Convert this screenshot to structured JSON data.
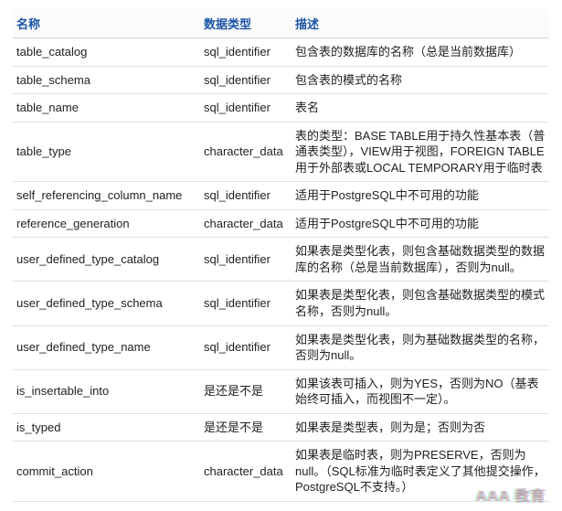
{
  "headers": {
    "name": "名称",
    "datatype": "数据类型",
    "desc": "描述"
  },
  "rows": [
    {
      "name": "table_catalog",
      "datatype": "sql_identifier",
      "desc": "包含表的数据库的名称（总是当前数据库）"
    },
    {
      "name": "table_schema",
      "datatype": "sql_identifier",
      "desc": "包含表的模式的名称"
    },
    {
      "name": "table_name",
      "datatype": "sql_identifier",
      "desc": "表名"
    },
    {
      "name": "table_type",
      "datatype": "character_data",
      "desc": "表的类型：BASE TABLE用于持久性基本表（普通表类型），VIEW用于视图，FOREIGN TABLE用于外部表或LOCAL TEMPORARY用于临时表"
    },
    {
      "name": "self_referencing_column_name",
      "datatype": "sql_identifier",
      "desc": "适用于PostgreSQL中不可用的功能"
    },
    {
      "name": "reference_generation",
      "datatype": "character_data",
      "desc": "适用于PostgreSQL中不可用的功能"
    },
    {
      "name": "user_defined_type_catalog",
      "datatype": "sql_identifier",
      "desc": "如果表是类型化表，则包含基础数据类型的数据库的名称（总是当前数据库），否则为null。"
    },
    {
      "name": "user_defined_type_schema",
      "datatype": "sql_identifier",
      "desc": "如果表是类型化表，则包含基础数据类型的模式名称，否则为null。"
    },
    {
      "name": "user_defined_type_name",
      "datatype": "sql_identifier",
      "desc": "如果表是类型化表，则为基础数据类型的名称，否则为null。"
    },
    {
      "name": "is_insertable_into",
      "datatype": "是还是不是",
      "desc": "如果该表可插入，则为YES，否则为NO（基表始终可插入，而视图不一定）。"
    },
    {
      "name": "is_typed",
      "datatype": "是还是不是",
      "desc": "如果表是类型表，则为是；否则为否"
    },
    {
      "name": "commit_action",
      "datatype": "character_data",
      "desc": "如果表是临时表，则为PRESERVE，否则为null。（SQL标准为临时表定义了其他提交操作，PostgreSQL不支持。）"
    }
  ],
  "watermark": "AAA 教育"
}
